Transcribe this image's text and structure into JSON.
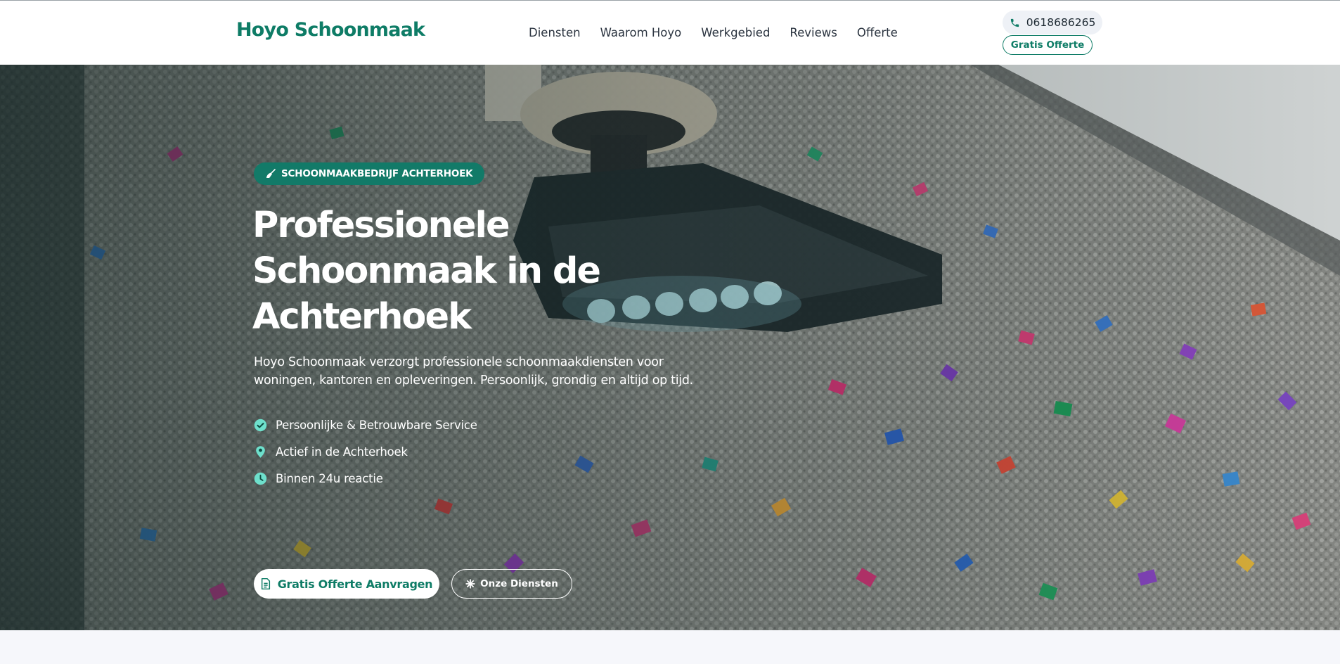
{
  "header": {
    "logo": "Hoyo Schoonmaak",
    "nav": [
      {
        "label": "Diensten"
      },
      {
        "label": "Waarom Hoyo"
      },
      {
        "label": "Werkgebied"
      },
      {
        "label": "Reviews"
      },
      {
        "label": "Offerte"
      }
    ],
    "phone": "0618686265",
    "cta": "Gratis Offerte"
  },
  "hero": {
    "badge": "SCHOONMAAKBEDRIJF ACHTERHOEK",
    "title": "Professionele Schoonmaak in de Achterhoek",
    "description": "Hoyo Schoonmaak verzorgt professionele schoonmaakdiensten voor woningen, kantoren en opleveringen. Persoonlijk, grondig en altijd op tijd.",
    "features": [
      {
        "icon": "check-circle-icon",
        "label": "Persoonlijke & Betrouwbare Service"
      },
      {
        "icon": "map-pin-icon",
        "label": "Actief in de Achterhoek"
      },
      {
        "icon": "clock-icon",
        "label": "Binnen 24u reactie"
      }
    ],
    "primary_button": "Gratis Offerte Aanvragen",
    "secondary_button": "Onze Diensten"
  },
  "colors": {
    "brand": "#0e7c66",
    "badge": "#127a68",
    "icon_accent": "#6ee0cc"
  }
}
